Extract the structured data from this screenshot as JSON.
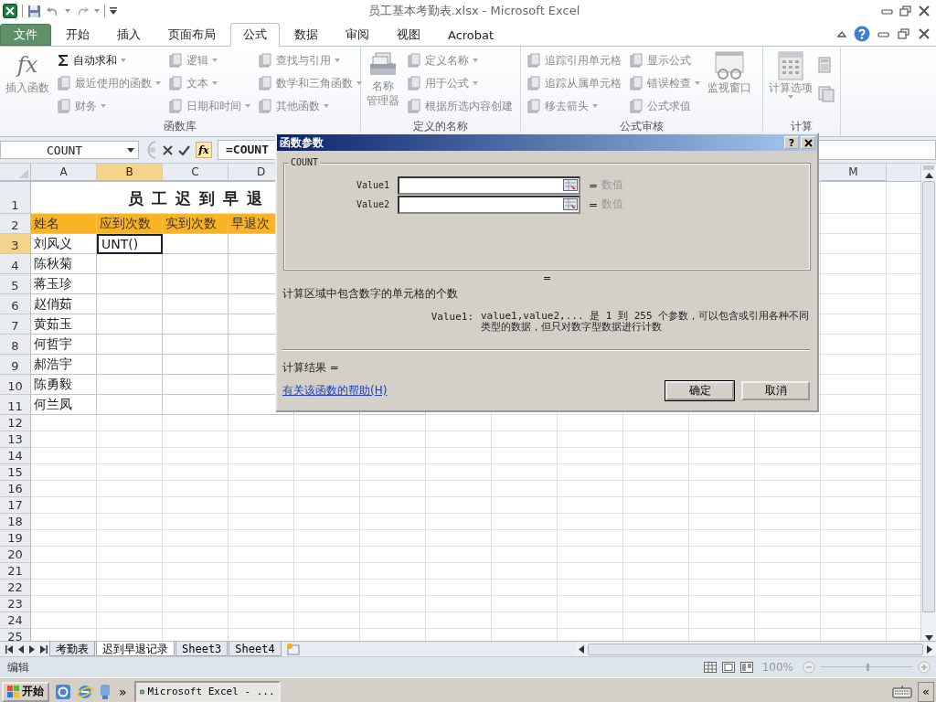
{
  "window": {
    "title": "员工基本考勤表.xlsx - Microsoft Excel"
  },
  "ribbon_tabs": [
    {
      "label": "文件",
      "kind": "file",
      "selected": false
    },
    {
      "label": "开始",
      "kind": "tab",
      "selected": false
    },
    {
      "label": "插入",
      "kind": "tab",
      "selected": false
    },
    {
      "label": "页面布局",
      "kind": "tab",
      "selected": false
    },
    {
      "label": "公式",
      "kind": "tab",
      "selected": true
    },
    {
      "label": "数据",
      "kind": "tab",
      "selected": false
    },
    {
      "label": "审阅",
      "kind": "tab",
      "selected": false
    },
    {
      "label": "视图",
      "kind": "tab",
      "selected": false
    },
    {
      "label": "Acrobat",
      "kind": "tab",
      "selected": false
    }
  ],
  "ribbon_groups": [
    {
      "label": "函数库",
      "blocks": [
        {
          "kind": "large",
          "lines": [
            "插入函数"
          ],
          "icon_text": "fx",
          "disabled": true,
          "dropdown": false
        },
        {
          "kind": "column",
          "items": [
            {
              "label": "自动求和",
              "disabled": false,
              "dropdown": true
            },
            {
              "label": "最近使用的函数",
              "disabled": true,
              "dropdown": true
            },
            {
              "label": "财务",
              "disabled": true,
              "dropdown": true
            }
          ]
        },
        {
          "kind": "column",
          "items": [
            {
              "label": "逻辑",
              "disabled": true,
              "dropdown": true
            },
            {
              "label": "文本",
              "disabled": true,
              "dropdown": true
            },
            {
              "label": "日期和时间",
              "disabled": true,
              "dropdown": true
            }
          ]
        },
        {
          "kind": "column",
          "items": [
            {
              "label": "查找与引用",
              "disabled": true,
              "dropdown": true
            },
            {
              "label": "数学和三角函数",
              "disabled": true,
              "dropdown": true
            },
            {
              "label": "其他函数",
              "disabled": true,
              "dropdown": true
            }
          ]
        }
      ]
    },
    {
      "label": "定义的名称",
      "blocks": [
        {
          "kind": "large",
          "lines": [
            "名称",
            "管理器"
          ],
          "disabled": true,
          "dropdown": false
        },
        {
          "kind": "column",
          "items": [
            {
              "label": "定义名称",
              "disabled": true,
              "dropdown": true
            },
            {
              "label": "用于公式",
              "disabled": true,
              "dropdown": true
            },
            {
              "label": "根据所选内容创建",
              "disabled": true,
              "dropdown": false
            }
          ]
        }
      ]
    },
    {
      "label": "公式审核",
      "blocks": [
        {
          "kind": "column",
          "items": [
            {
              "label": "追踪引用单元格",
              "disabled": true,
              "dropdown": false
            },
            {
              "label": "追踪从属单元格",
              "disabled": true,
              "dropdown": false
            },
            {
              "label": "移去箭头",
              "disabled": true,
              "dropdown": true
            }
          ]
        },
        {
          "kind": "column",
          "items": [
            {
              "label": "显示公式",
              "disabled": true,
              "dropdown": false
            },
            {
              "label": "错误检查",
              "disabled": true,
              "dropdown": true
            },
            {
              "label": "公式求值",
              "disabled": true,
              "dropdown": false
            }
          ]
        },
        {
          "kind": "large",
          "lines": [
            "监视窗口"
          ],
          "disabled": true,
          "dropdown": false
        }
      ]
    },
    {
      "label": "计算",
      "blocks": [
        {
          "kind": "large",
          "lines": [
            "计算选项"
          ],
          "disabled": true,
          "dropdown": true
        },
        {
          "kind": "icon_column"
        }
      ]
    }
  ],
  "formula_bar": {
    "name_box": "COUNT",
    "fx": "fx",
    "formula": "=COUNT"
  },
  "sheet": {
    "columns": [
      {
        "label": "A",
        "selected": false
      },
      {
        "label": "B",
        "selected": true
      },
      {
        "label": "C",
        "selected": false
      },
      {
        "label": "D",
        "selected": false
      },
      {
        "label": "M",
        "selected": false
      }
    ],
    "rows": [
      {
        "number": "1",
        "kind": "title",
        "selected": false,
        "cells": [
          "员工迟到早退"
        ]
      },
      {
        "number": "2",
        "kind": "header",
        "selected": false,
        "cells": [
          "姓名",
          "应到次数",
          "实到次数",
          "早退次"
        ]
      },
      {
        "number": "3",
        "kind": "data",
        "selected": true,
        "cells": [
          {
            "text": "刘风义",
            "active": false
          },
          {
            "text": "UNT()",
            "active": true
          }
        ]
      },
      {
        "number": "4",
        "kind": "data",
        "selected": false,
        "cells": [
          {
            "text": "陈秋菊",
            "active": false
          }
        ]
      },
      {
        "number": "5",
        "kind": "data",
        "selected": false,
        "cells": [
          {
            "text": "蒋玉珍",
            "active": false
          }
        ]
      },
      {
        "number": "6",
        "kind": "data",
        "selected": false,
        "cells": [
          {
            "text": "赵俏茹",
            "active": false
          }
        ]
      },
      {
        "number": "7",
        "kind": "data",
        "selected": false,
        "cells": [
          {
            "text": "黄茹玉",
            "active": false
          }
        ]
      },
      {
        "number": "8",
        "kind": "data",
        "selected": false,
        "cells": [
          {
            "text": "何哲宇",
            "active": false
          }
        ]
      },
      {
        "number": "9",
        "kind": "data",
        "selected": false,
        "cells": [
          {
            "text": "郝浩宇",
            "active": false
          }
        ]
      },
      {
        "number": "10",
        "kind": "data",
        "selected": false,
        "cells": [
          {
            "text": "陈勇毅",
            "active": false
          }
        ]
      },
      {
        "number": "11",
        "kind": "data",
        "selected": false,
        "cells": [
          {
            "text": "何兰凤",
            "active": false
          }
        ]
      },
      {
        "number": "12",
        "kind": "empty",
        "selected": false
      },
      {
        "number": "13",
        "kind": "empty",
        "selected": false
      },
      {
        "number": "14",
        "kind": "empty",
        "selected": false
      },
      {
        "number": "15",
        "kind": "empty",
        "selected": false
      },
      {
        "number": "16",
        "kind": "empty",
        "selected": false
      },
      {
        "number": "17",
        "kind": "empty",
        "selected": false
      },
      {
        "number": "18",
        "kind": "empty",
        "selected": false
      },
      {
        "number": "19",
        "kind": "empty",
        "selected": false
      },
      {
        "number": "20",
        "kind": "empty",
        "selected": false
      },
      {
        "number": "21",
        "kind": "empty",
        "selected": false
      },
      {
        "number": "22",
        "kind": "empty",
        "selected": false
      },
      {
        "number": "23",
        "kind": "empty",
        "selected": false
      },
      {
        "number": "24",
        "kind": "empty",
        "selected": false
      },
      {
        "number": "25",
        "kind": "empty",
        "selected": false
      }
    ]
  },
  "sheet_tabs": [
    {
      "label": "考勤表",
      "selected": false
    },
    {
      "label": "迟到早退记录",
      "selected": true
    },
    {
      "label": "Sheet3",
      "selected": false
    },
    {
      "label": "Sheet4",
      "selected": false
    }
  ],
  "status_bar": {
    "mode": "编辑",
    "zoom": "100%",
    "zoom_slider": {
      "level": 0.5
    }
  },
  "taskbar": {
    "start": "开始",
    "more": "»",
    "windows": [
      {
        "label": "Microsoft Excel - ...",
        "selected": true
      }
    ],
    "tray_toggle": "«"
  },
  "dialog": {
    "title": "函数参数",
    "help": "?",
    "function": "COUNT",
    "arguments": [
      {
        "label": "Value1",
        "equals": "=",
        "hint": "数值"
      },
      {
        "label": "Value2",
        "equals": "=",
        "hint": "数值"
      }
    ],
    "result_equals": "=",
    "description": "计算区域中包含数字的单元格的个数",
    "arg_help_label": "Value1:",
    "arg_help": "value1,value2,... 是 1 到 255 个参数，可以包含或引用各种不同类型的数据，但只对数字型数据进行计数",
    "result_label": "计算结果 =",
    "help_link": "有关该函数的帮助(H)",
    "buttons": [
      {
        "label": "确定",
        "default": true
      },
      {
        "label": "取消",
        "default": false
      }
    ]
  }
}
